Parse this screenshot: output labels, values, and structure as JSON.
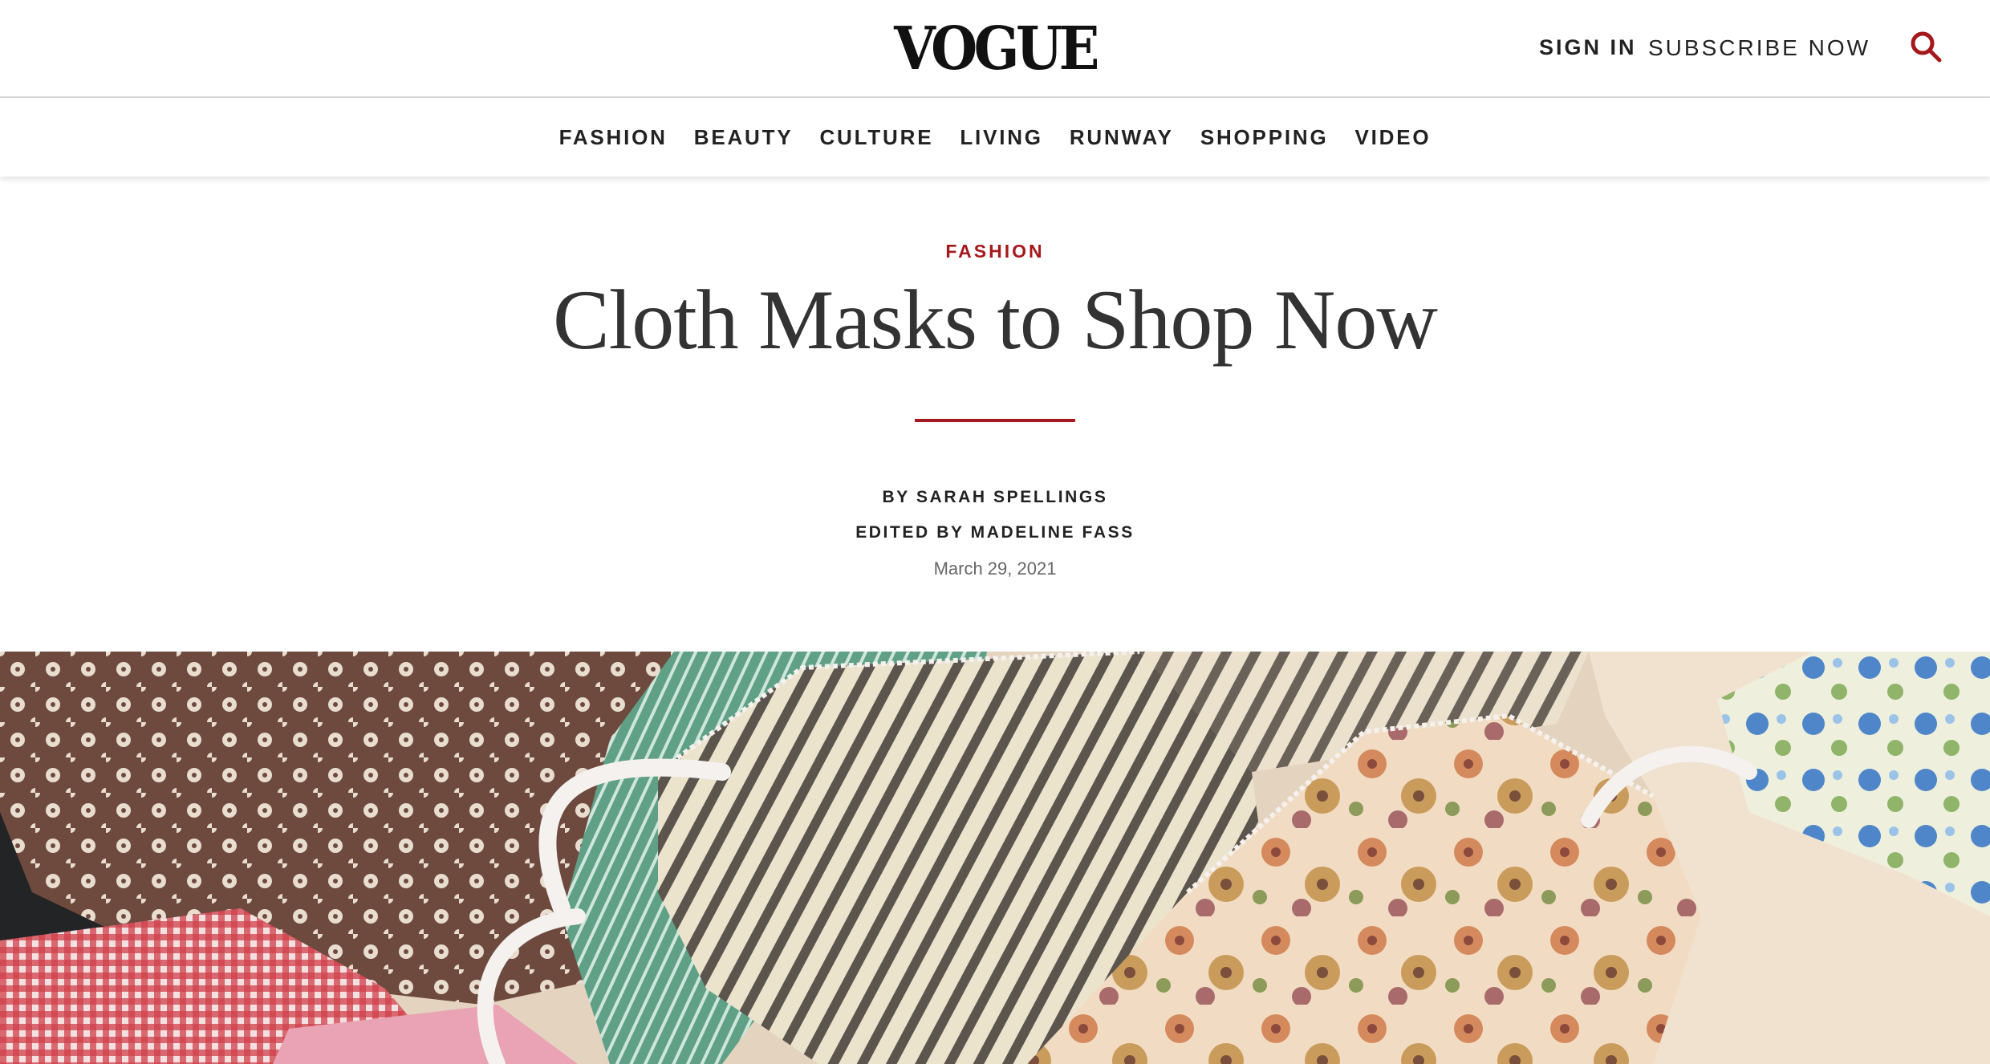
{
  "header": {
    "logo": "VOGUE",
    "sign_in": "SIGN IN",
    "subscribe": "SUBSCRIBE NOW",
    "search_icon": "search-icon",
    "accent_color": "#a5191c"
  },
  "nav": {
    "items": [
      "FASHION",
      "BEAUTY",
      "CULTURE",
      "LIVING",
      "RUNWAY",
      "SHOPPING",
      "VIDEO"
    ]
  },
  "article": {
    "rubric": "FASHION",
    "title": "Cloth Masks to Shop Now",
    "byline": "BY SARAH SPELLINGS",
    "edited_by": "EDITED BY MADELINE FASS",
    "date": "March 29, 2021"
  }
}
